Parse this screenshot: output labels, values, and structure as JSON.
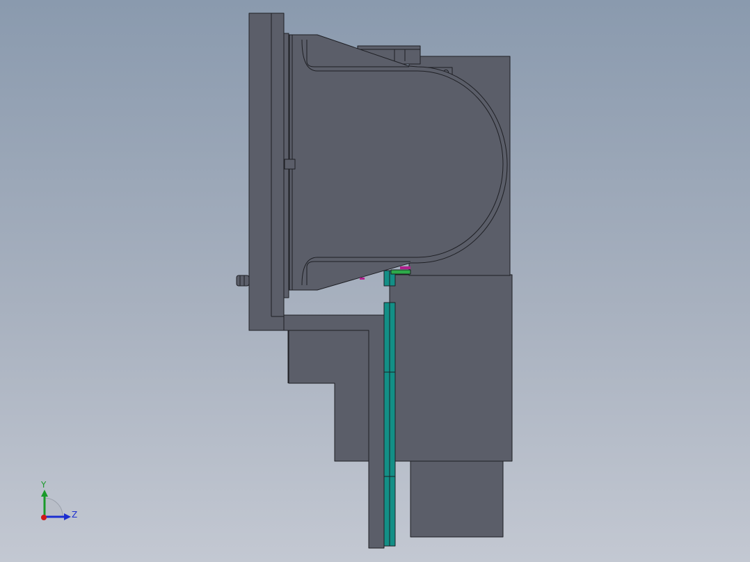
{
  "viewport": {
    "background_top": "#8a9aae",
    "background_bottom": "#c3c8d2"
  },
  "colors": {
    "body_fill": "#5b5e69",
    "edge": "#1e1f24",
    "teal": "#138f86",
    "green": "#2eaa4a",
    "magenta": "#b0208c"
  },
  "triad": {
    "y_label": "Y",
    "z_label": "Z",
    "y_color": "#1a9a2a",
    "z_color": "#1c2ed0",
    "x_color": "#d01818"
  }
}
